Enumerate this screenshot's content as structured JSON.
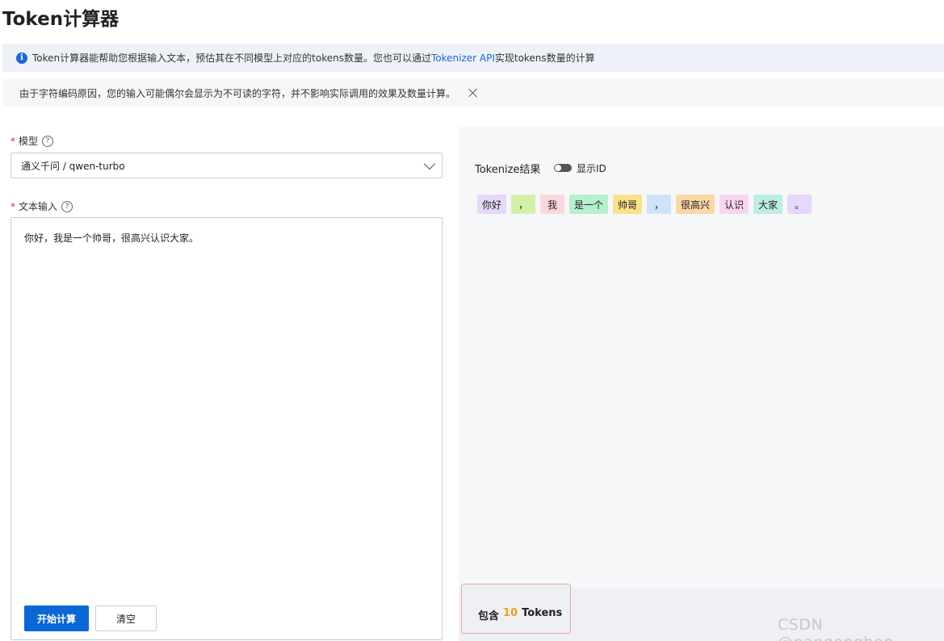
{
  "page": {
    "title": "Token计算器"
  },
  "info": {
    "icon": "info-icon",
    "text_before": "Token计算器能帮助您根据输入文本，预估其在不同模型上对应的tokens数量。您也可以通过",
    "link": "Tokenizer API",
    "text_after": "实现tokens数量的计算"
  },
  "warning": {
    "text": "由于字符编码原因，您的输入可能偶尔会显示为不可读的字符，并不影响实际调用的效果及数量计算。"
  },
  "model": {
    "required": "*",
    "label": "模型",
    "value": "通义千问 / qwen-turbo"
  },
  "text_input": {
    "required": "*",
    "label": "文本输入",
    "value": "你好，我是一个帅哥，很高兴认识大家。"
  },
  "buttons": {
    "calculate": "开始计算",
    "clear": "清空"
  },
  "result": {
    "title": "Tokenize结果",
    "toggle_label": "显示ID",
    "toggle_on": false,
    "tokens": [
      {
        "text": "你好",
        "color": "#e5d8fb"
      },
      {
        "text": "，",
        "color": "#d3f0a6"
      },
      {
        "text": "我",
        "color": "#fbd8de"
      },
      {
        "text": "是一个",
        "color": "#b6f0cc"
      },
      {
        "text": "帅哥",
        "color": "#fbe28a"
      },
      {
        "text": "，",
        "color": "#cfe2fb"
      },
      {
        "text": "很高兴",
        "color": "#fbd7a8"
      },
      {
        "text": "认识",
        "color": "#f8d6f2"
      },
      {
        "text": "大家",
        "color": "#bdeee4"
      },
      {
        "text": "。",
        "color": "#e5d8fb"
      }
    ],
    "count_prefix": "包含",
    "count": "10",
    "count_suffix": "Tokens"
  },
  "watermark": "CSDN @nangonghen"
}
